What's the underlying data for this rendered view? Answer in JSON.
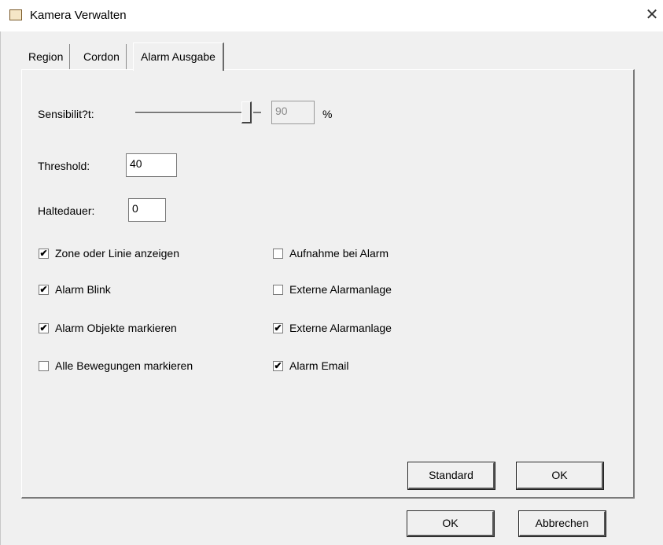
{
  "window": {
    "title": "Kamera Verwalten",
    "close_glyph": "✕",
    "icon": "app-icon"
  },
  "tabs": [
    {
      "label": "Region",
      "active": false
    },
    {
      "label": "Cordon",
      "active": false
    },
    {
      "label": "Alarm Ausgabe",
      "active": true
    }
  ],
  "sensitivity": {
    "label": "Sensibilit?t:",
    "value": "90",
    "unit": "%",
    "slider_level": 0.9
  },
  "threshold": {
    "label": "Threshold:",
    "value": "40"
  },
  "haltedauer": {
    "label": "Haltedauer:",
    "value": "0"
  },
  "checkboxes_left": [
    {
      "label": "Zone oder Linie anzeigen",
      "checked": true
    },
    {
      "label": "Alarm Blink",
      "checked": true
    },
    {
      "label": "Alarm Objekte markieren",
      "checked": true
    },
    {
      "label": "Alle Bewegungen markieren",
      "checked": false
    }
  ],
  "checkboxes_right": [
    {
      "label": "Aufnahme bei Alarm",
      "checked": false
    },
    {
      "label": "Externe Alarmanlage",
      "checked": false
    },
    {
      "label": "Externe Alarmanlage",
      "checked": true
    },
    {
      "label": "Alarm Email",
      "checked": true
    }
  ],
  "panel_buttons": {
    "standard": "Standard",
    "ok": "OK"
  },
  "dialog_buttons": {
    "ok": "OK",
    "cancel": "Abbrechen"
  },
  "check_glyph": "✔"
}
